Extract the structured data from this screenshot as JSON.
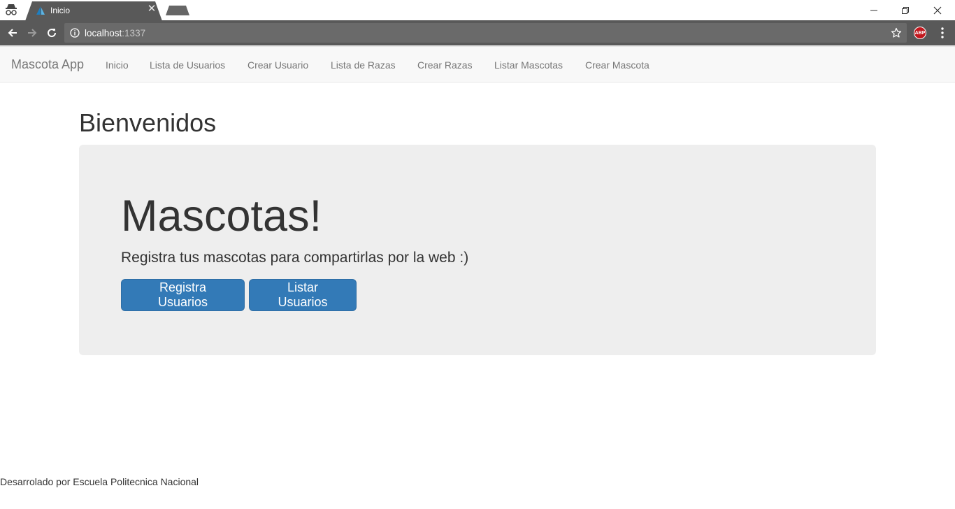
{
  "browser": {
    "tab": {
      "title": "Inicio"
    },
    "url": {
      "host": "localhost",
      "port": ":1337"
    },
    "extensions": {
      "adblock_label": "ABP"
    }
  },
  "navbar": {
    "brand": "Mascota App",
    "items": [
      {
        "label": "Inicio"
      },
      {
        "label": "Lista de Usuarios"
      },
      {
        "label": "Crear Usuario"
      },
      {
        "label": "Lista de Razas"
      },
      {
        "label": "Crear Razas"
      },
      {
        "label": "Listar Mascotas"
      },
      {
        "label": "Crear Mascota"
      }
    ]
  },
  "main": {
    "heading": "Bienvenidos",
    "jumbotron": {
      "title": "Mascotas!",
      "lead": "Registra tus mascotas para compartirlas por la web :)",
      "buttons": [
        {
          "label": "Registra Usuarios"
        },
        {
          "label": "Listar Usuarios"
        }
      ]
    }
  },
  "footer": {
    "text": "Desarrolado por Escuela Politecnica Nacional"
  },
  "colors": {
    "primary_button": "#337ab7",
    "navbar_bg": "#f8f8f8",
    "jumbotron_bg": "#eeeeee",
    "browser_chrome": "#595959"
  }
}
